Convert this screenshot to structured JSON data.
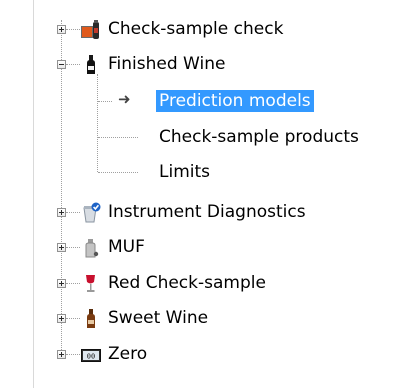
{
  "tree": {
    "nodes": [
      {
        "label": "Check-sample check",
        "icon": "check-sample-check-icon",
        "expanded": false
      },
      {
        "label": "Finished Wine",
        "icon": "wine-bottle-icon",
        "expanded": true,
        "children": [
          {
            "label": "Prediction models",
            "selected": true,
            "marker": "➜"
          },
          {
            "label": "Check-sample products"
          },
          {
            "label": "Limits"
          }
        ]
      },
      {
        "label": "Instrument Diagnostics",
        "icon": "instrument-diagnostics-icon",
        "expanded": false
      },
      {
        "label": "MUF",
        "icon": "muf-icon",
        "expanded": false
      },
      {
        "label": "Red Check-sample",
        "icon": "red-wine-glass-icon",
        "expanded": false
      },
      {
        "label": "Sweet Wine",
        "icon": "sweet-wine-bottle-icon",
        "expanded": false
      },
      {
        "label": "Zero",
        "icon": "zero-display-icon",
        "expanded": false
      }
    ]
  },
  "colors": {
    "selection": "#3399ff",
    "selection_text": "#ffffff",
    "tree_lines": "#a0a0a0"
  }
}
